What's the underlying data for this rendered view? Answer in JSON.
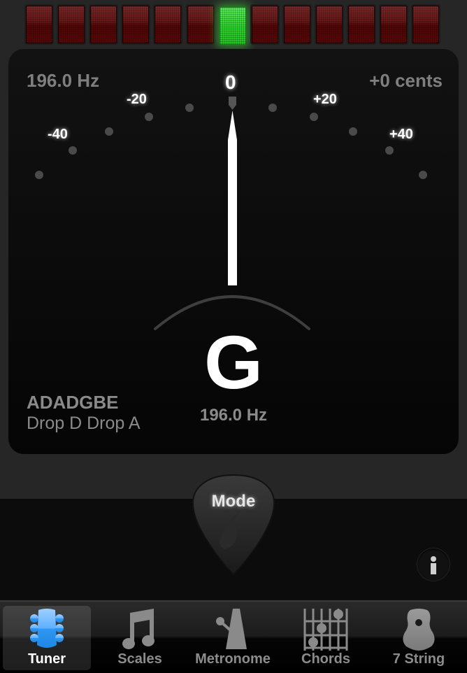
{
  "meter": {
    "segments": 13,
    "active_segment": 7,
    "colors": {
      "off": "#6a1818",
      "on": "#3be03b"
    }
  },
  "display": {
    "frequency_top": "196.0 Hz",
    "cents": "+0 cents",
    "scale": {
      "zero": "0",
      "minus20": "-20",
      "plus20": "+20",
      "minus40": "-40",
      "plus40": "+40"
    },
    "needle_cents": 0,
    "note": "G",
    "frequency_bottom": "196.0 Hz",
    "tuning": "ADADGBE",
    "tuning_name": "Drop D Drop A"
  },
  "controls": {
    "mode_label": "Mode",
    "info_icon": "info-icon"
  },
  "tabbar": {
    "active": 0,
    "items": [
      {
        "label": "Tuner",
        "icon": "guitar-headstock-icon"
      },
      {
        "label": "Scales",
        "icon": "music-note-icon"
      },
      {
        "label": "Metronome",
        "icon": "metronome-icon"
      },
      {
        "label": "Chords",
        "icon": "chord-diagram-icon"
      },
      {
        "label": "7 String",
        "icon": "guitar-body-icon"
      }
    ]
  }
}
